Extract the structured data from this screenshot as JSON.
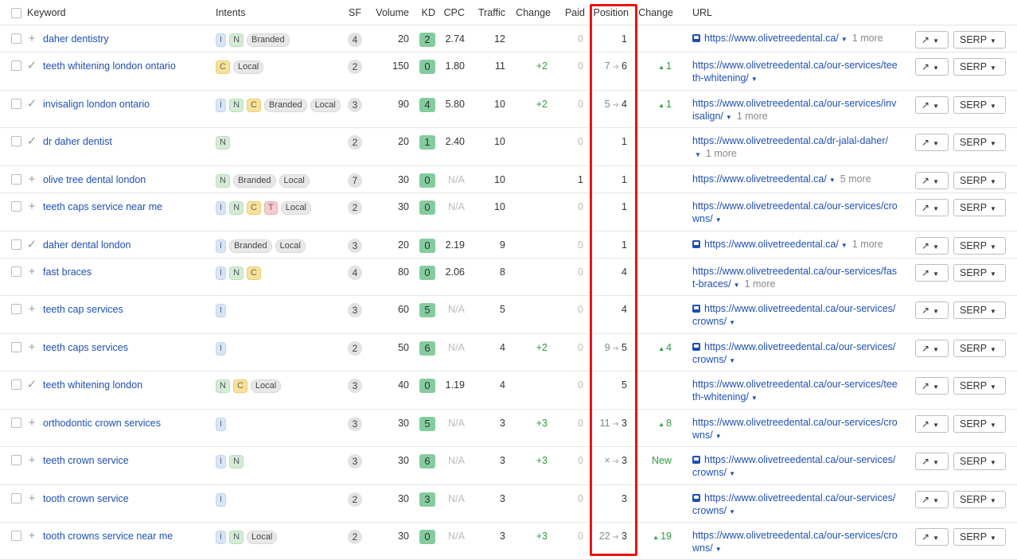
{
  "headers": {
    "keyword": "Keyword",
    "intents": "Intents",
    "sf": "SF",
    "volume": "Volume",
    "kd": "KD",
    "cpc": "CPC",
    "traffic": "Traffic",
    "change": "Change",
    "paid": "Paid",
    "position": "Position",
    "pos_change": "Change",
    "url": "URL"
  },
  "buttons": {
    "serp": "SERP"
  },
  "icons": {
    "add": "plus-icon",
    "added": "check-icon",
    "chart": "trend-chart-icon",
    "sitelinks": "image-sitelink-icon"
  },
  "colors": {
    "highlight": "#ee1111",
    "link": "#1f4fb0",
    "positive": "#2e9b3e",
    "kd_low": "#84cc9e"
  },
  "rows": [
    {
      "keyword": "daher dentistry",
      "action": "+",
      "intents": [
        "I",
        "N",
        "Branded"
      ],
      "sf": "4",
      "volume": "20",
      "kd": "2",
      "cpc": "2.74",
      "traffic": "12",
      "change": "",
      "paid": "0",
      "pos_from": "",
      "pos": "1",
      "pos_change": "",
      "url": "https://www.olivetreedental.ca/",
      "more": "1 more",
      "icon": true
    },
    {
      "keyword": "teeth whitening london ontario",
      "action": "✓",
      "intents": [
        "C",
        "Local"
      ],
      "sf": "2",
      "volume": "150",
      "kd": "0",
      "cpc": "1.80",
      "traffic": "11",
      "change": "+2",
      "paid": "0",
      "pos_from": "7",
      "pos": "6",
      "pos_change": "1",
      "url": "https://www.olivetreedental.ca/our-services/teeth-whitening/",
      "more": "",
      "icon": false
    },
    {
      "keyword": "invisalign london ontario",
      "action": "✓",
      "intents": [
        "I",
        "N",
        "C",
        "Branded",
        "Local"
      ],
      "sf": "3",
      "volume": "90",
      "kd": "4",
      "cpc": "5.80",
      "traffic": "10",
      "change": "+2",
      "paid": "0",
      "pos_from": "5",
      "pos": "4",
      "pos_change": "1",
      "url": "https://www.olivetreedental.ca/our-services/invisalign/",
      "more": "1 more",
      "icon": false
    },
    {
      "keyword": "dr daher dentist",
      "action": "✓",
      "intents": [
        "N"
      ],
      "sf": "2",
      "volume": "20",
      "kd": "1",
      "cpc": "2.40",
      "traffic": "10",
      "change": "",
      "paid": "0",
      "pos_from": "",
      "pos": "1",
      "pos_change": "",
      "url": "https://www.olivetreedental.ca/dr-jalal-daher/",
      "more": "1 more",
      "icon": false
    },
    {
      "keyword": "olive tree dental london",
      "action": "+",
      "intents": [
        "N",
        "Branded",
        "Local"
      ],
      "sf": "7",
      "volume": "30",
      "kd": "0",
      "cpc": "N/A",
      "traffic": "10",
      "change": "",
      "paid": "1",
      "pos_from": "",
      "pos": "1",
      "pos_change": "",
      "url": "https://www.olivetreedental.ca/",
      "more": "5 more",
      "icon": false
    },
    {
      "keyword": "teeth caps service near me",
      "action": "+",
      "intents": [
        "I",
        "N",
        "C",
        "T",
        "Local"
      ],
      "sf": "2",
      "volume": "30",
      "kd": "0",
      "cpc": "N/A",
      "traffic": "10",
      "change": "",
      "paid": "0",
      "pos_from": "",
      "pos": "1",
      "pos_change": "",
      "url": "https://www.olivetreedental.ca/our-services/crowns/",
      "more": "",
      "icon": false
    },
    {
      "keyword": "daher dental london",
      "action": "✓",
      "intents": [
        "I",
        "Branded",
        "Local"
      ],
      "sf": "3",
      "volume": "20",
      "kd": "0",
      "cpc": "2.19",
      "traffic": "9",
      "change": "",
      "paid": "0",
      "pos_from": "",
      "pos": "1",
      "pos_change": "",
      "url": "https://www.olivetreedental.ca/",
      "more": "1 more",
      "icon": true
    },
    {
      "keyword": "fast braces",
      "action": "+",
      "intents": [
        "I",
        "N",
        "C"
      ],
      "sf": "4",
      "volume": "80",
      "kd": "0",
      "cpc": "2.06",
      "traffic": "8",
      "change": "",
      "paid": "0",
      "pos_from": "",
      "pos": "4",
      "pos_change": "",
      "url": "https://www.olivetreedental.ca/our-services/fast-braces/",
      "more": "1 more",
      "icon": false
    },
    {
      "keyword": "teeth cap services",
      "action": "+",
      "intents": [
        "I"
      ],
      "sf": "3",
      "volume": "60",
      "kd": "5",
      "cpc": "N/A",
      "traffic": "5",
      "change": "",
      "paid": "0",
      "pos_from": "",
      "pos": "4",
      "pos_change": "",
      "url": "https://www.olivetreedental.ca/our-services/crowns/",
      "more": "",
      "icon": true
    },
    {
      "keyword": "teeth caps services",
      "action": "+",
      "intents": [
        "I"
      ],
      "sf": "2",
      "volume": "50",
      "kd": "6",
      "cpc": "N/A",
      "traffic": "4",
      "change": "+2",
      "paid": "0",
      "pos_from": "9",
      "pos": "5",
      "pos_change": "4",
      "url": "https://www.olivetreedental.ca/our-services/crowns/",
      "more": "",
      "icon": true
    },
    {
      "keyword": "teeth whitening london",
      "action": "✓",
      "intents": [
        "N",
        "C",
        "Local"
      ],
      "sf": "3",
      "volume": "40",
      "kd": "0",
      "cpc": "1.19",
      "traffic": "4",
      "change": "",
      "paid": "0",
      "pos_from": "",
      "pos": "5",
      "pos_change": "",
      "url": "https://www.olivetreedental.ca/our-services/teeth-whitening/",
      "more": "",
      "icon": false
    },
    {
      "keyword": "orthodontic crown services",
      "action": "+",
      "intents": [
        "I"
      ],
      "sf": "3",
      "volume": "30",
      "kd": "5",
      "cpc": "N/A",
      "traffic": "3",
      "change": "+3",
      "paid": "0",
      "pos_from": "11",
      "pos": "3",
      "pos_change": "8",
      "url": "https://www.olivetreedental.ca/our-services/crowns/",
      "more": "",
      "icon": false
    },
    {
      "keyword": "teeth crown service",
      "action": "+",
      "intents": [
        "I",
        "N"
      ],
      "sf": "3",
      "volume": "30",
      "kd": "6",
      "cpc": "N/A",
      "traffic": "3",
      "change": "+3",
      "paid": "0",
      "pos_from": "×",
      "pos": "3",
      "pos_change": "New",
      "url": "https://www.olivetreedental.ca/our-services/crowns/",
      "more": "",
      "icon": true
    },
    {
      "keyword": "tooth crown service",
      "action": "+",
      "intents": [
        "I"
      ],
      "sf": "2",
      "volume": "30",
      "kd": "3",
      "cpc": "N/A",
      "traffic": "3",
      "change": "",
      "paid": "0",
      "pos_from": "",
      "pos": "3",
      "pos_change": "",
      "url": "https://www.olivetreedental.ca/our-services/crowns/",
      "more": "",
      "icon": true
    },
    {
      "keyword": "tooth crowns service near me",
      "action": "+",
      "intents": [
        "I",
        "N",
        "Local"
      ],
      "sf": "2",
      "volume": "30",
      "kd": "0",
      "cpc": "N/A",
      "traffic": "3",
      "change": "+3",
      "paid": "0",
      "pos_from": "22",
      "pos": "3",
      "pos_change": "19",
      "url": "https://www.olivetreedental.ca/our-services/crowns/",
      "more": "",
      "icon": false
    }
  ]
}
